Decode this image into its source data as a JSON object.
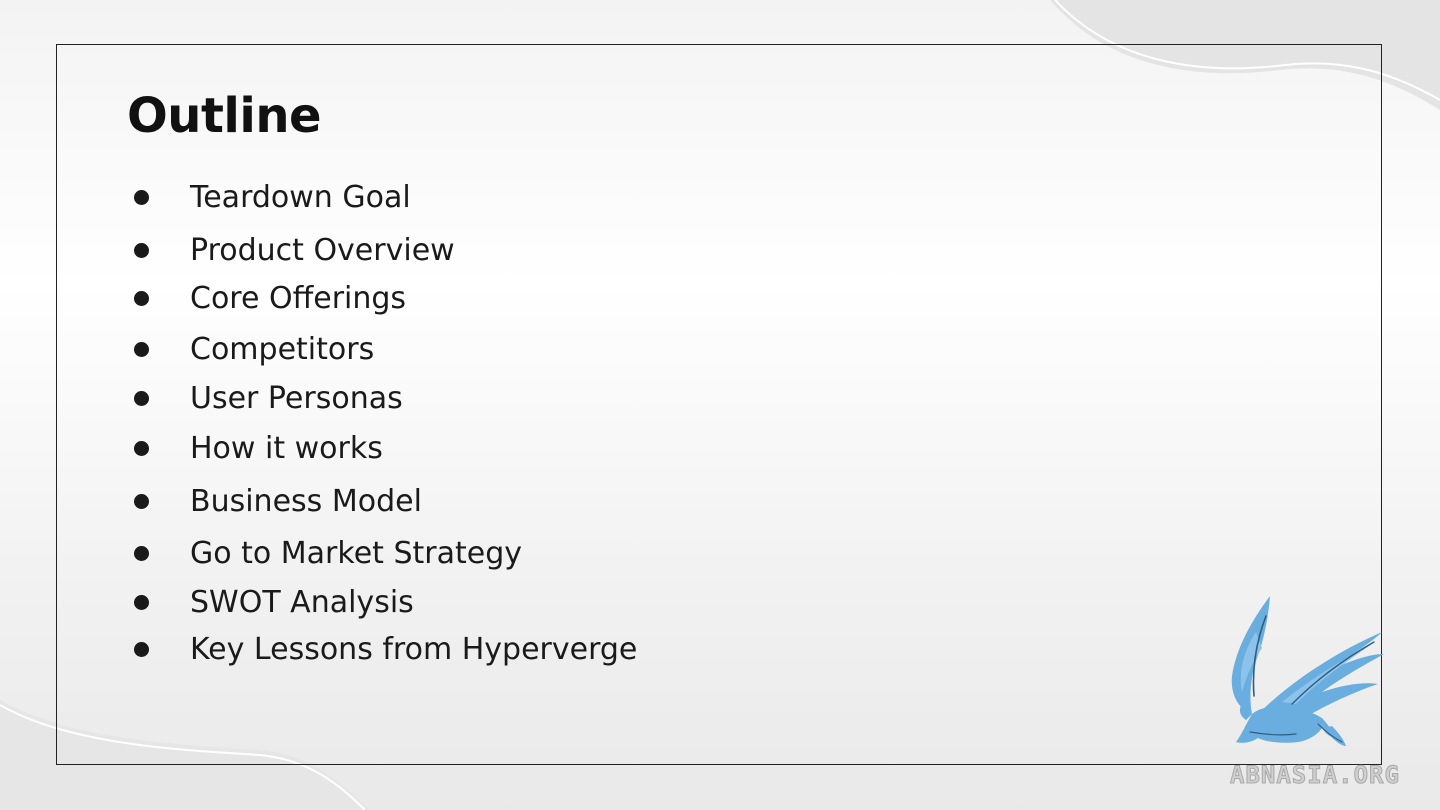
{
  "slide": {
    "title": "Outline",
    "items": [
      "Teardown Goal",
      "Product Overview",
      "Core Offerings",
      "Competitors",
      "User Personas",
      "How it works",
      "Business Model",
      "Go to Market Strategy",
      "SWOT Analysis",
      "Key Lessons from Hyperverge"
    ]
  },
  "watermark": {
    "text": "ABNASIA.ORG",
    "logo_icon": "griffin-logo-icon"
  },
  "colors": {
    "text": "#1a1a1a",
    "frame": "#222222",
    "logo": "#6aaee0",
    "watermark": "#bdbdbd"
  }
}
